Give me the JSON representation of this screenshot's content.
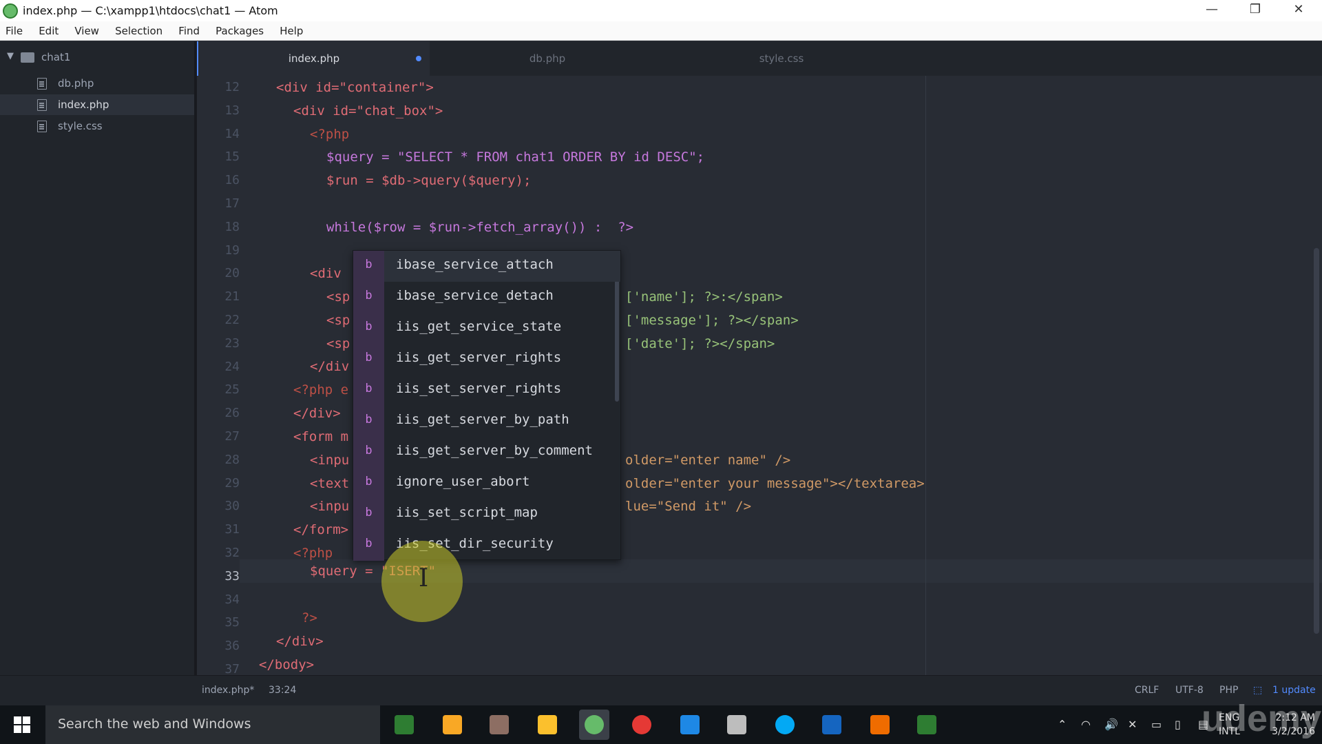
{
  "window": {
    "title": "index.php — C:\\xampp1\\htdocs\\chat1 — Atom",
    "minimize": "—",
    "maximize": "❐",
    "close": "✕"
  },
  "menu": [
    "File",
    "Edit",
    "View",
    "Selection",
    "Find",
    "Packages",
    "Help"
  ],
  "tree": {
    "root": "chat1",
    "files": [
      "db.php",
      "index.php",
      "style.css"
    ],
    "selected": "index.php"
  },
  "tabs": [
    {
      "label": "index.php",
      "active": true,
      "modified": true
    },
    {
      "label": "db.php",
      "active": false,
      "modified": false
    },
    {
      "label": "style.css",
      "active": false,
      "modified": false
    }
  ],
  "editor": {
    "line_numbers": [
      "12",
      "13",
      "14",
      "15",
      "16",
      "17",
      "18",
      "19",
      "20",
      "21",
      "22",
      "23",
      "24",
      "25",
      "26",
      "27",
      "28",
      "29",
      "30",
      "31",
      "32",
      "33",
      "34",
      "35",
      "36",
      "37"
    ],
    "current_line": "33",
    "lines": {
      "l12": "<div id=\"container\">",
      "l13": "<div id=\"chat_box\">",
      "l14": "<?php",
      "l15": "$query = \"SELECT * FROM chat1 ORDER BY id DESC\";",
      "l16": "$run = $db->query($query);",
      "l18": "while($row = $run->fetch_array()) :  ?>",
      "l20": "<div",
      "l21a": "<sp",
      "l21b": "['name']; ?>:</span>",
      "l22a": "<sp",
      "l22b": "['message']; ?></span>",
      "l23a": "<sp",
      "l23b": "['date']; ?></span>",
      "l24": "</div",
      "l25": "<?php e",
      "l26": "</div>",
      "l27": "<form m",
      "l28a": "<inpu",
      "l28b": "older=\"enter name\" />",
      "l29a": "<text",
      "l29b": "older=\"enter your message\"></textarea>",
      "l30a": "<inpu",
      "l30b": "lue=\"Send it\" />",
      "l31": "</form>",
      "l32": "<?php",
      "l33": "$query = \"ISERT\"",
      "l35": "?>",
      "l36": "</div>",
      "l37": "</body>"
    }
  },
  "autocomplete": {
    "badge": "b",
    "items": [
      "ibase_service_attach",
      "ibase_service_detach",
      "iis_get_service_state",
      "iis_get_server_rights",
      "iis_set_server_rights",
      "iis_get_server_by_path",
      "iis_get_server_by_comment",
      "ignore_user_abort",
      "iis_set_script_map",
      "iis_set_dir_security"
    ],
    "selected_index": 0
  },
  "status": {
    "file": "index.php*",
    "cursor": "33:24",
    "line_ending": "CRLF",
    "encoding": "UTF-8",
    "grammar": "PHP",
    "update": "1 update"
  },
  "taskbar": {
    "search_placeholder": "Search the web and Windows",
    "apps": [
      "camtasia-icon",
      "paint-icon",
      "tools-icon",
      "file-explorer-icon",
      "atom-icon",
      "chrome-icon",
      "edge-icon",
      "notepad-icon",
      "skype-icon",
      "word-icon",
      "xampp-icon",
      "camtasia-recorder-icon"
    ],
    "lang_top": "ENG",
    "lang_bottom": "INTL",
    "time": "2:12 AM",
    "date": "3/2/2016"
  },
  "watermark": "udemy",
  "colors": {
    "accent": "#528bff",
    "editor_bg": "#282c34",
    "sidebar_bg": "#21252b"
  }
}
